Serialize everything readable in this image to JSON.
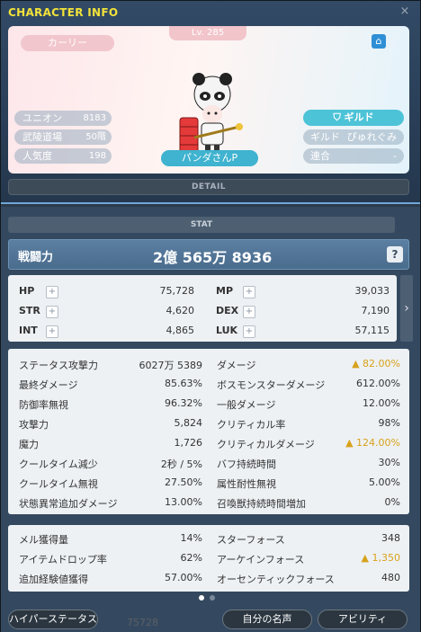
{
  "window": {
    "title": "CHARACTER INFO",
    "close": "×"
  },
  "profile": {
    "nickname": "カーリー",
    "level": "Lv. 285",
    "left_stats": [
      {
        "label": "ユニオン",
        "value": "8183"
      },
      {
        "label": "武陵道場",
        "value": "50階"
      },
      {
        "label": "人気度",
        "value": "198"
      }
    ],
    "guild_button": "ギルド",
    "right_stats": [
      {
        "label": "ギルド",
        "value": "ぴゅれぐみ"
      },
      {
        "label": "連合",
        "value": "-"
      }
    ],
    "character_name": "パンダさんP",
    "detail_button": "DETAIL"
  },
  "stat": {
    "header": "STAT",
    "combat_power_label": "戦闘力",
    "combat_power_value": "2億 565万 8936",
    "help": "?",
    "basic": [
      {
        "label": "HP",
        "value": "75,728"
      },
      {
        "label": "MP",
        "value": "39,033"
      },
      {
        "label": "STR",
        "value": "4,620"
      },
      {
        "label": "DEX",
        "value": "7,190"
      },
      {
        "label": "INT",
        "value": "4,865"
      },
      {
        "label": "LUK",
        "value": "57,115"
      }
    ],
    "plus": "+",
    "side_arrow": "›",
    "details": [
      {
        "label": "ステータス攻撃力",
        "value": "6027万 5389"
      },
      {
        "label": "ダメージ",
        "value": "▲ 82.00%"
      },
      {
        "label": "最終ダメージ",
        "value": "85.63%"
      },
      {
        "label": "ボスモンスターダメージ",
        "value": "612.00%"
      },
      {
        "label": "防御率無視",
        "value": "96.32%"
      },
      {
        "label": "一般ダメージ",
        "value": "12.00%"
      },
      {
        "label": "攻撃力",
        "value": "5,824"
      },
      {
        "label": "クリティカル率",
        "value": "98%"
      },
      {
        "label": "魔力",
        "value": "1,726"
      },
      {
        "label": "クリティカルダメージ",
        "value": "▲ 124.00%"
      },
      {
        "label": "クールタイム減少",
        "value": "2秒 / 5%"
      },
      {
        "label": "バフ持続時間",
        "value": "30%"
      },
      {
        "label": "クールタイム無視",
        "value": "27.50%"
      },
      {
        "label": "属性耐性無視",
        "value": "5.00%"
      },
      {
        "label": "状態異常追加ダメージ",
        "value": "13.00%"
      },
      {
        "label": "召喚獣持続時間増加",
        "value": "0%"
      }
    ],
    "misc": [
      {
        "label": "メル獲得量",
        "value": "14%"
      },
      {
        "label": "スターフォース",
        "value": "348"
      },
      {
        "label": "アイテムドロップ率",
        "value": "62%"
      },
      {
        "label": "アーケインフォース",
        "value": "▲ 1,350"
      },
      {
        "label": "追加経験値獲得",
        "value": "57.00%"
      },
      {
        "label": "オーセンティックフォース",
        "value": "480"
      }
    ]
  },
  "footer": {
    "hyper_stat": "ハイパーステータス",
    "my_fame": "自分の名声",
    "ability": "アビリティ",
    "ghost_value": "75728"
  },
  "colors": {
    "accent_gold": "#f2e23a",
    "stat_gold": "#d7a21c",
    "guild_cyan": "#4dc3d7"
  }
}
